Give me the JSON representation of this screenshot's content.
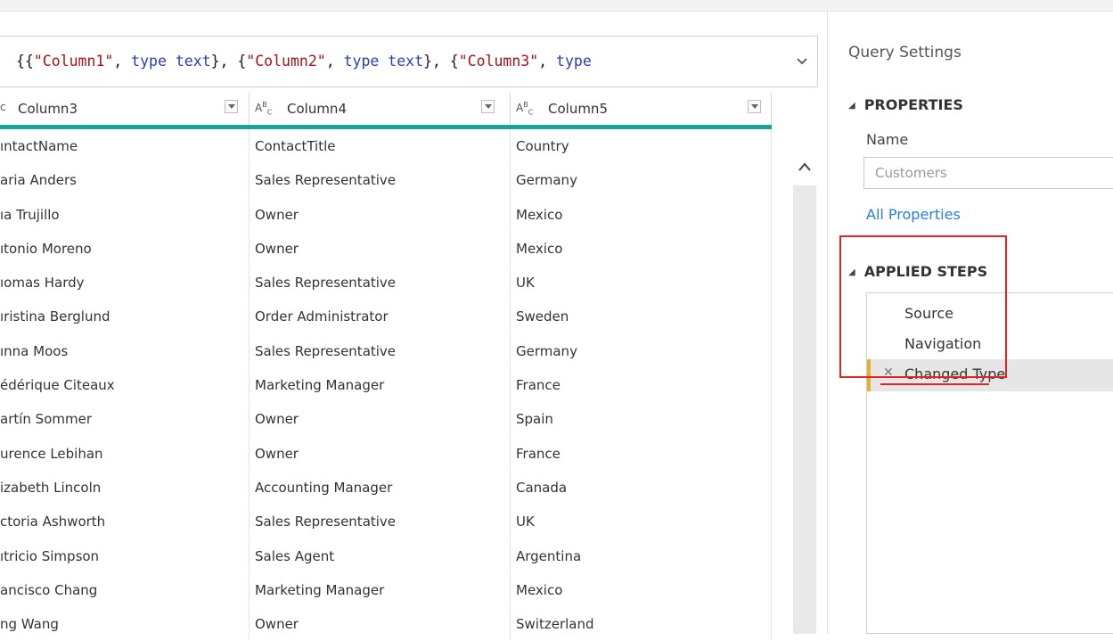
{
  "formula": {
    "segments": [
      {
        "text": "{{",
        "cls": ""
      },
      {
        "text": "\"Column1\"",
        "cls": "str"
      },
      {
        "text": ", ",
        "cls": ""
      },
      {
        "text": "type text",
        "cls": "kw"
      },
      {
        "text": "}, {",
        "cls": ""
      },
      {
        "text": "\"Column2\"",
        "cls": "str"
      },
      {
        "text": ", ",
        "cls": ""
      },
      {
        "text": "type text",
        "cls": "kw"
      },
      {
        "text": "}, {",
        "cls": ""
      },
      {
        "text": "\"Column3\"",
        "cls": "str"
      },
      {
        "text": ", ",
        "cls": ""
      },
      {
        "text": "type",
        "cls": "kw"
      }
    ]
  },
  "grid": {
    "columns": [
      {
        "label": "Column3",
        "icon": "c"
      },
      {
        "label": "Column4",
        "icon": "ABC"
      },
      {
        "label": "Column5",
        "icon": "ABC"
      }
    ],
    "rows": [
      [
        "ıntactName",
        "ContactTitle",
        "Country"
      ],
      [
        "aria Anders",
        "Sales Representative",
        "Germany"
      ],
      [
        "ıa Trujillo",
        "Owner",
        "Mexico"
      ],
      [
        "ıtonio Moreno",
        "Owner",
        "Mexico"
      ],
      [
        "ıomas Hardy",
        "Sales Representative",
        "UK"
      ],
      [
        "ıristina Berglund",
        "Order Administrator",
        "Sweden"
      ],
      [
        "ınna Moos",
        "Sales Representative",
        "Germany"
      ],
      [
        "édérique Citeaux",
        "Marketing Manager",
        "France"
      ],
      [
        "artín Sommer",
        "Owner",
        "Spain"
      ],
      [
        "urence Lebihan",
        "Owner",
        "France"
      ],
      [
        "izabeth Lincoln",
        "Accounting Manager",
        "Canada"
      ],
      [
        "ctoria Ashworth",
        "Sales Representative",
        "UK"
      ],
      [
        "ıtricio Simpson",
        "Sales Agent",
        "Argentina"
      ],
      [
        "ancisco Chang",
        "Marketing Manager",
        "Mexico"
      ],
      [
        "ng Wang",
        "Owner",
        "Switzerland"
      ]
    ]
  },
  "query_settings": {
    "title": "Query Settings",
    "properties_heading": "PROPERTIES",
    "name_label": "Name",
    "name_value": "Customers",
    "all_properties": "All Properties",
    "applied_steps_heading": "APPLIED STEPS",
    "steps": [
      {
        "label": "Source",
        "selected": false
      },
      {
        "label": "Navigation",
        "selected": false
      },
      {
        "label": "Changed Type",
        "selected": true
      }
    ]
  },
  "colors": {
    "accent_teal": "#19a39b",
    "link_blue": "#2b7cd3",
    "highlight_red": "#e0231e",
    "step_marker_yellow": "#e3b22a"
  },
  "icons": [
    "chevron-down-icon",
    "dropdown-arrow-icon",
    "scroll-up-icon",
    "collapse-triangle-icon",
    "delete-step-icon"
  ]
}
